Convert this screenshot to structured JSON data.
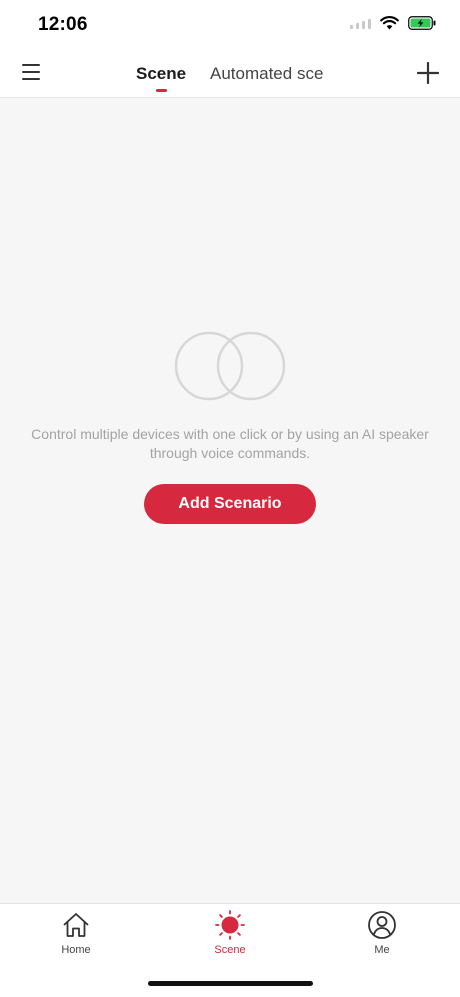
{
  "status_bar": {
    "time": "12:06"
  },
  "header": {
    "tabs": [
      {
        "label": "Scene",
        "active": true
      },
      {
        "label": "Automated sce",
        "active": false
      }
    ]
  },
  "empty_state": {
    "message": "Control multiple devices with one click or by using an AI speaker through voice commands.",
    "button_label": "Add Scenario"
  },
  "bottom_nav": {
    "items": [
      {
        "label": "Home",
        "icon": "home-icon",
        "active": false
      },
      {
        "label": "Scene",
        "icon": "scene-sun-icon",
        "active": true
      },
      {
        "label": "Me",
        "icon": "user-icon",
        "active": false
      }
    ]
  },
  "colors": {
    "accent": "#d6283f",
    "background": "#f6f6f6",
    "battery": "#34c759"
  }
}
